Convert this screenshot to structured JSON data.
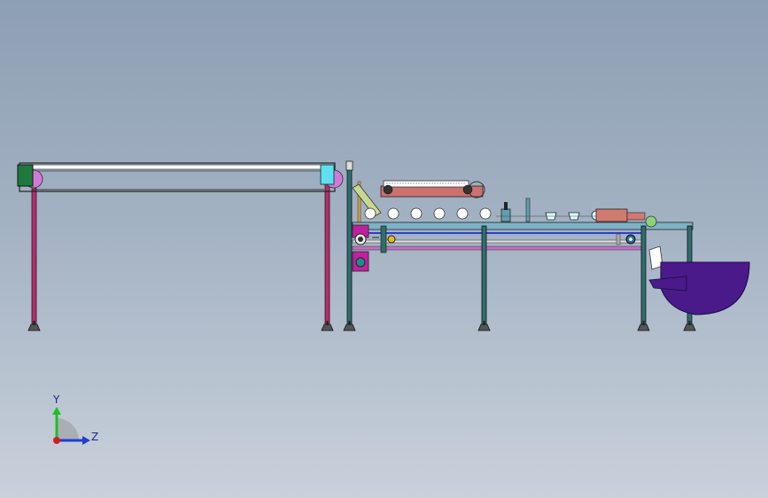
{
  "axis_triad": {
    "y_label": "Y",
    "z_label": "Z",
    "colors": {
      "y": "#1fbf1f",
      "z": "#1f3fd0",
      "x": "#d01f1f"
    }
  },
  "colors": {
    "leg": "#b0306a",
    "frame": "#2a2a2a",
    "belt": "#ffffff",
    "green_block": "#1e7a3c",
    "cyan_block": "#5fe0f0",
    "pulley": "#d07ad8",
    "purple_hopper": "#4a1a8a",
    "table_top": "#7fb2c7",
    "rail_pink": "#c070c0",
    "rail_blue": "#3040c0",
    "magenta_box": "#c020a0",
    "salmon_block": "#d07a70",
    "teal_leg": "#2f6f6a"
  }
}
